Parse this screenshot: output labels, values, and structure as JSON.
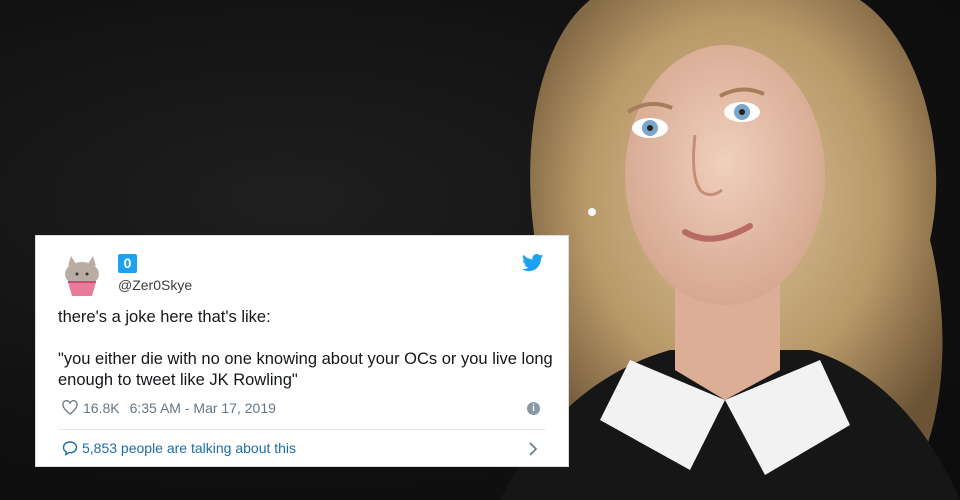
{
  "tweet": {
    "display_name": "0",
    "handle": "@Zer0Skye",
    "text": "there's a joke here that's like:\n\n\"you either die with no one knowing about your OCs or you live long enough to tweet like JK Rowling\"",
    "likes": "16.8K",
    "timestamp": "6:35 AM - Mar 17, 2019",
    "conversation": "5,853 people are talking about this"
  },
  "icons": {
    "avatar": "pusheen-cupcake-avatar",
    "brand": "twitter-bird-icon",
    "like": "heart-icon",
    "info": "info-icon",
    "reply": "speech-bubble-icon",
    "more": "chevron-right-icon"
  },
  "colors": {
    "twitter_blue": "#1da1f2",
    "link_blue": "#1b6ea8",
    "meta_gray": "#657786",
    "text": "#14171a"
  }
}
